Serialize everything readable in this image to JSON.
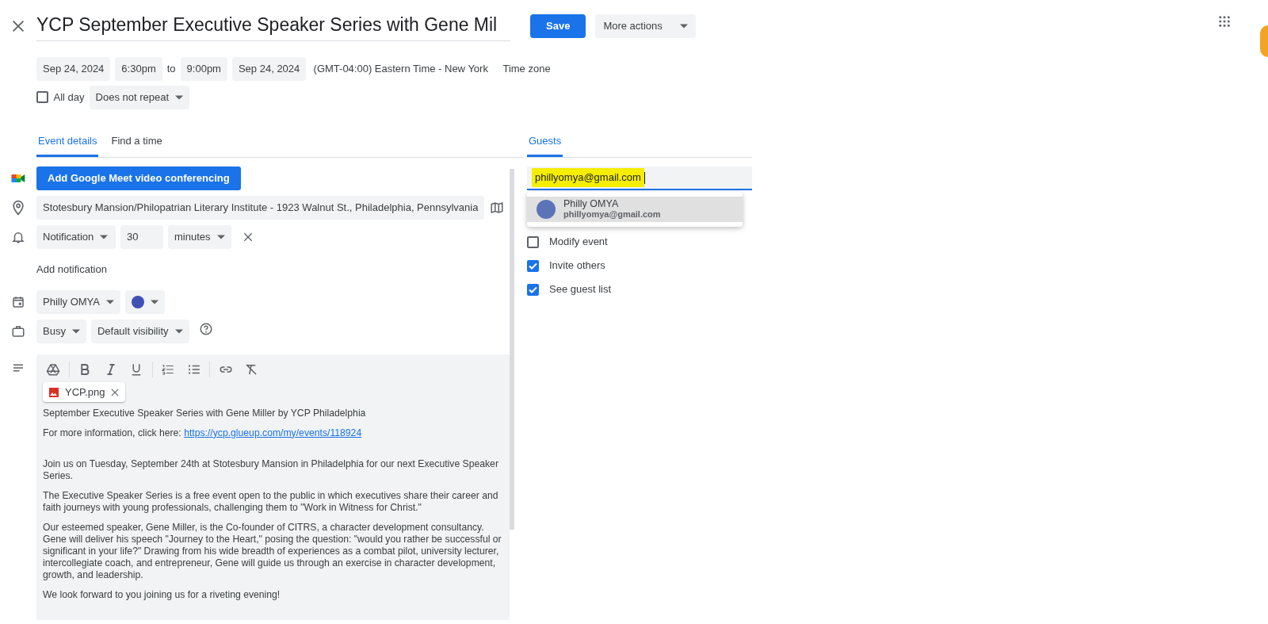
{
  "header": {
    "title": "YCP September Executive Speaker Series with Gene Mil",
    "save": "Save",
    "more_actions": "More actions"
  },
  "datetime": {
    "start_date": "Sep 24, 2024",
    "start_time": "6:30pm",
    "to": "to",
    "end_time": "9:00pm",
    "end_date": "Sep 24, 2024",
    "timezone": "(GMT-04:00) Eastern Time - New York",
    "timezone_button": "Time zone"
  },
  "all_day": {
    "label": "All day",
    "checked": false
  },
  "repeat": "Does not repeat",
  "tabs": [
    {
      "label": "Event details",
      "selected": true
    },
    {
      "label": "Find a time",
      "selected": false
    }
  ],
  "meet_button": "Add Google Meet video conferencing",
  "location": "Stotesbury Mansion/Philopatrian Literary Institute - 1923 Walnut St., Philadelphia, Pennsylvania",
  "notification": {
    "type": "Notification",
    "value": "30",
    "unit": "minutes"
  },
  "add_notification": "Add notification",
  "calendar": {
    "name": "Philly OMYA",
    "color": "#3f51b5"
  },
  "availability": "Busy",
  "visibility": "Default visibility",
  "attachment": "YCP.png",
  "description": [
    {
      "text": "September Executive Speaker Series with Gene Miller by YCP Philadelphia"
    },
    {
      "text": "For more information, click here: ",
      "link": "https://ycp.glueup.com/my/events/118924"
    },
    {
      "text": "Join us on Tuesday, September 24th at Stotesbury Mansion in Philadelphia for our next Executive Speaker Series."
    },
    {
      "text": "The Executive Speaker Series is a free event open to the public in which executives share their career and faith journeys with young professionals, challenging them to \"Work in Witness for Christ.\""
    },
    {
      "text": "Our esteemed speaker, Gene Miller, is the Co-founder of CITRS, a character development consultancy. Gene will deliver his speech \"Journey to the Heart,\" posing the question: \"would you rather be successful or significant in your life?\" Drawing from his wide breadth of experiences as a combat pilot, university lecturer, intercollegiate coach, and entrepreneur, Gene will guide us through an exercise in character development, growth, and leadership."
    },
    {
      "text": "We look forward to you joining us for a riveting evening!"
    }
  ],
  "guests": {
    "tab": {
      "label": "Guests",
      "selected": true
    },
    "input": {
      "value": "phillyomya@gmail.com",
      "highlighted": true
    },
    "suggestions": [
      {
        "name": "Philly OMYA",
        "email": "phillyomya@gmail.com",
        "selected": true
      }
    ],
    "permissions": [
      {
        "label": "Modify event",
        "checked": false
      },
      {
        "label": "Invite others",
        "checked": true
      },
      {
        "label": "See guest list",
        "checked": true
      }
    ]
  }
}
